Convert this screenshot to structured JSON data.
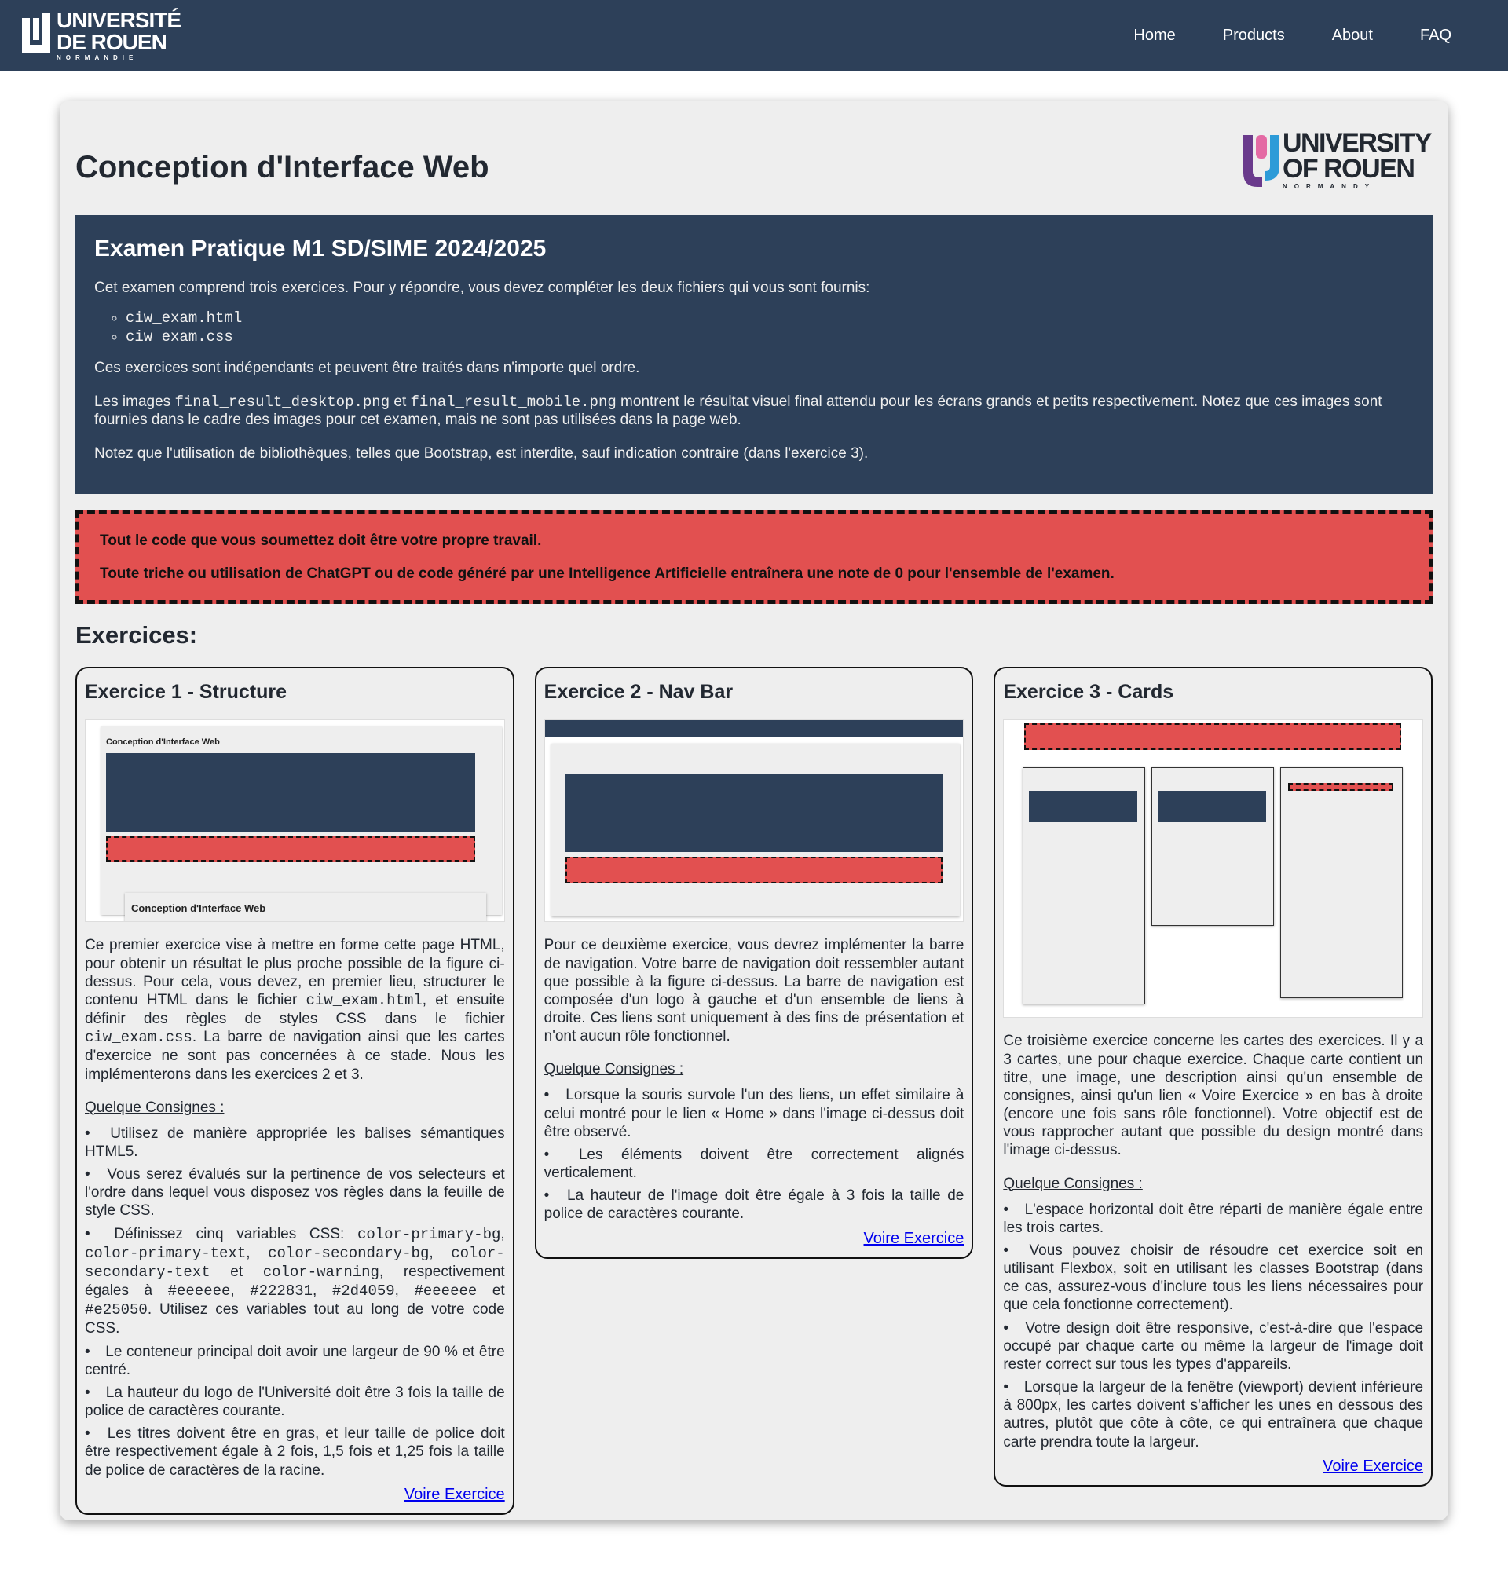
{
  "brand": {
    "line1": "UNIVERSITÉ",
    "line2": "DE ROUEN",
    "line3": "NORMANDIE"
  },
  "nav": {
    "items": [
      "Home",
      "Products",
      "About",
      "FAQ"
    ]
  },
  "logo_en": {
    "line1": "UNIVERSITY",
    "line2": "OF ROUEN",
    "line3": "NORMANDY"
  },
  "header": {
    "title": "Conception d'Interface Web"
  },
  "intro": {
    "heading": "Examen Pratique M1 SD/SIME 2024/2025",
    "p1": "Cet examen comprend trois exercices. Pour y répondre, vous devez compléter les deux fichiers qui vous sont fournis:",
    "files": [
      "ciw_exam.html",
      "ciw_exam.css"
    ],
    "p2": "Ces exercices sont indépendants et peuvent être traités dans n'importe quel ordre.",
    "p3_a": "Les images ",
    "p3_code1": "final_result_desktop.png",
    "p3_b": " et ",
    "p3_code2": "final_result_mobile.png",
    "p3_c": " montrent le résultat visuel final attendu pour les écrans grands et petits respectivement. Notez que ces images sont fournies dans le cadre des images pour cet examen, mais ne sont pas utilisées dans la page web.",
    "p4": "Notez que l'utilisation de bibliothèques, telles que Bootstrap, est interdite, sauf indication contraire (dans l'exercice 3)."
  },
  "warning": {
    "line1": "Tout le code que vous soumettez doit être votre propre travail.",
    "line2": "Toute triche ou utilisation de ChatGPT ou de code généré par une Intelligence Artificielle entraînera une note de 0 pour l'ensemble de l'examen."
  },
  "exercises_title": "Exercices:",
  "cards": {
    "c1": {
      "title": "Exercice 1 - Structure",
      "thumb_title": "Conception d'Interface Web",
      "desc_a": "Ce premier exercice vise à mettre en forme cette page HTML, pour obtenir un résultat le plus proche possible de la figure ci-dessus. Pour cela, vous devez, en premier lieu, structurer le contenu HTML dans le fichier ",
      "desc_code1": "ciw_exam.html",
      "desc_b": ", et ensuite définir des règles de styles CSS dans le fichier ",
      "desc_code2": "ciw_exam.css",
      "desc_c": ". La barre de navigation ainsi que les cartes d'exercice ne sont pas concernées à ce stade. Nous les implémenterons dans les exercices 2 et 3.",
      "consignes": "Quelque Consignes :",
      "li1": "Utilisez de manière appropriée les balises sémantiques HTML5.",
      "li2": "Vous serez évalués sur la pertinence de vos selecteurs et l'ordre dans lequel vous disposez vos règles dans la feuille de style CSS.",
      "li3_a": "Définissez cinq variables CSS: ",
      "li3_v1": "color-primary-bg",
      "li3_v2": "color-primary-text",
      "li3_v3": "color-secondary-bg",
      "li3_v4": "color-secondary-text",
      "li3_and": " et ",
      "li3_v5": "color-warning",
      "li3_b": ", respectivement égales à ",
      "li3_h1": "#eeeeee",
      "li3_h2": "#222831",
      "li3_h3": "#2d4059",
      "li3_h4": "#eeeeee",
      "li3_h5": "#e25050",
      "li3_c": ". Utilisez ces variables tout au long de votre code CSS.",
      "li4": "Le conteneur principal doit avoir une largeur de 90 % et être centré.",
      "li5": "La hauteur du logo de l'Université doit être 3 fois la taille de police de caractères courante.",
      "li6": "Les titres doivent être en gras, et leur taille de police doit être respectivement égale à 2 fois, 1,5 fois et 1,25 fois la taille de police de caractères de la racine.",
      "link": "Voire Exercice"
    },
    "c2": {
      "title": "Exercice 2 - Nav Bar",
      "desc": "Pour ce deuxième exercice, vous devrez implémenter la barre de navigation. Votre barre de navigation doit ressembler autant que possible à la figure ci-dessus. La barre de navigation est composée d'un logo à gauche et d'un ensemble de liens à droite. Ces liens sont uniquement à des fins de présentation et n'ont aucun rôle fonctionnel.",
      "consignes": "Quelque Consignes :",
      "li1": "Lorsque la souris survole l'un des liens, un effet similaire à celui montré pour le lien « Home » dans l'image ci-dessus doit être observé.",
      "li2": "Les éléments doivent être correctement alignés verticalement.",
      "li3": "La hauteur de l'image doit être égale à 3 fois la taille de police de caractères courante.",
      "link": "Voire Exercice"
    },
    "c3": {
      "title": "Exercice 3 - Cards",
      "desc": "Ce troisième exercice concerne les cartes des exercices. Il y a 3 cartes, une pour chaque exercice. Chaque carte contient un titre, une image, une description ainsi qu'un ensemble de consignes, ainsi qu'un lien « Voire Exercice » en bas à droite (encore une fois sans rôle fonctionnel). Votre objectif est de vous rapprocher autant que possible du design montré dans l'image ci-dessus.",
      "consignes": "Quelque Consignes :",
      "li1": "L'espace horizontal doit être réparti de manière égale entre les trois cartes.",
      "li2": "Vous pouvez choisir de résoudre cet exercice soit en utilisant Flexbox, soit en utilisant les classes Bootstrap (dans ce cas, assurez-vous d'inclure tous les liens nécessaires pour que cela fonctionne correctement).",
      "li3": "Votre design doit être responsive, c'est-à-dire que l'espace occupé par chaque carte ou même la largeur de l'image doit rester correct sur tous les types d'appareils.",
      "li4": "Lorsque la largeur de la fenêtre (viewport) devient inférieure à 800px, les cartes doivent s'afficher les unes en dessous des autres, plutôt que côte à côte, ce qui entraînera que chaque carte prendra toute la largeur.",
      "link": "Voire Exercice"
    }
  }
}
